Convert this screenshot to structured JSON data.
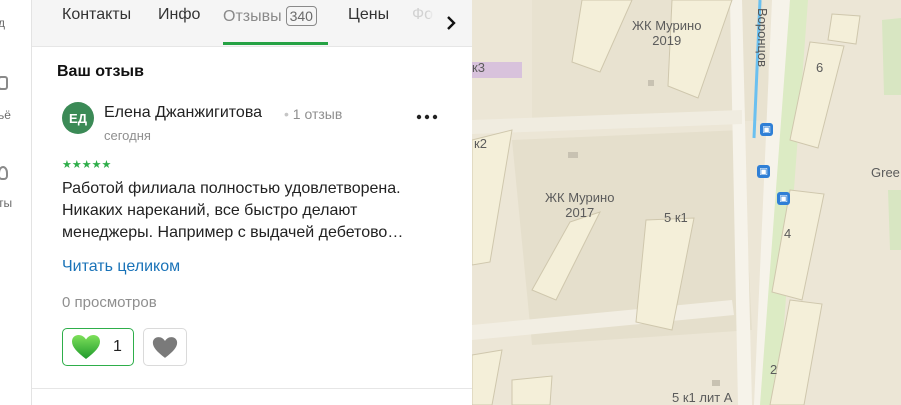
{
  "rail": {
    "fragments": [
      "д",
      "ьё",
      "ты"
    ]
  },
  "tabs": [
    {
      "label": "Контакты"
    },
    {
      "label": "Инфо"
    },
    {
      "label": "Отзывы",
      "count": "340"
    },
    {
      "label": "Цены"
    },
    {
      "label": "Фо"
    }
  ],
  "review": {
    "section_title": "Ваш отзыв",
    "avatar_initials": "ЕД",
    "author": "Елена Джанжигитова",
    "author_reviews": "1 отзыв",
    "date": "сегодня",
    "stars": "★★★★★",
    "rating": 5,
    "text": "Работой филиала полностью удовлетворена. Никаких нареканий, все быстро делают менеджеры. Например с выдачей дебетово…",
    "read_more": "Читать целиком",
    "views": "0 просмотров",
    "likes": "1"
  },
  "map": {
    "labels": {
      "zk2019_a": "ЖК Мурино",
      "zk2019_b": "2019",
      "zk2017_a": "ЖК Мурино",
      "zk2017_b": "2017",
      "b5k1": "5 к1",
      "b6": "6",
      "b4": "4",
      "b2": "2",
      "green": "Gree",
      "k2": "к2",
      "k3": "к3",
      "bottom": "5 к1 лит А"
    },
    "street": "Воронцов"
  },
  "colors": {
    "accent_green": "#2eae4a",
    "link_blue": "#1a73b8",
    "map_bg": "#ece6d6",
    "bus_blue": "#2f7fd6"
  }
}
